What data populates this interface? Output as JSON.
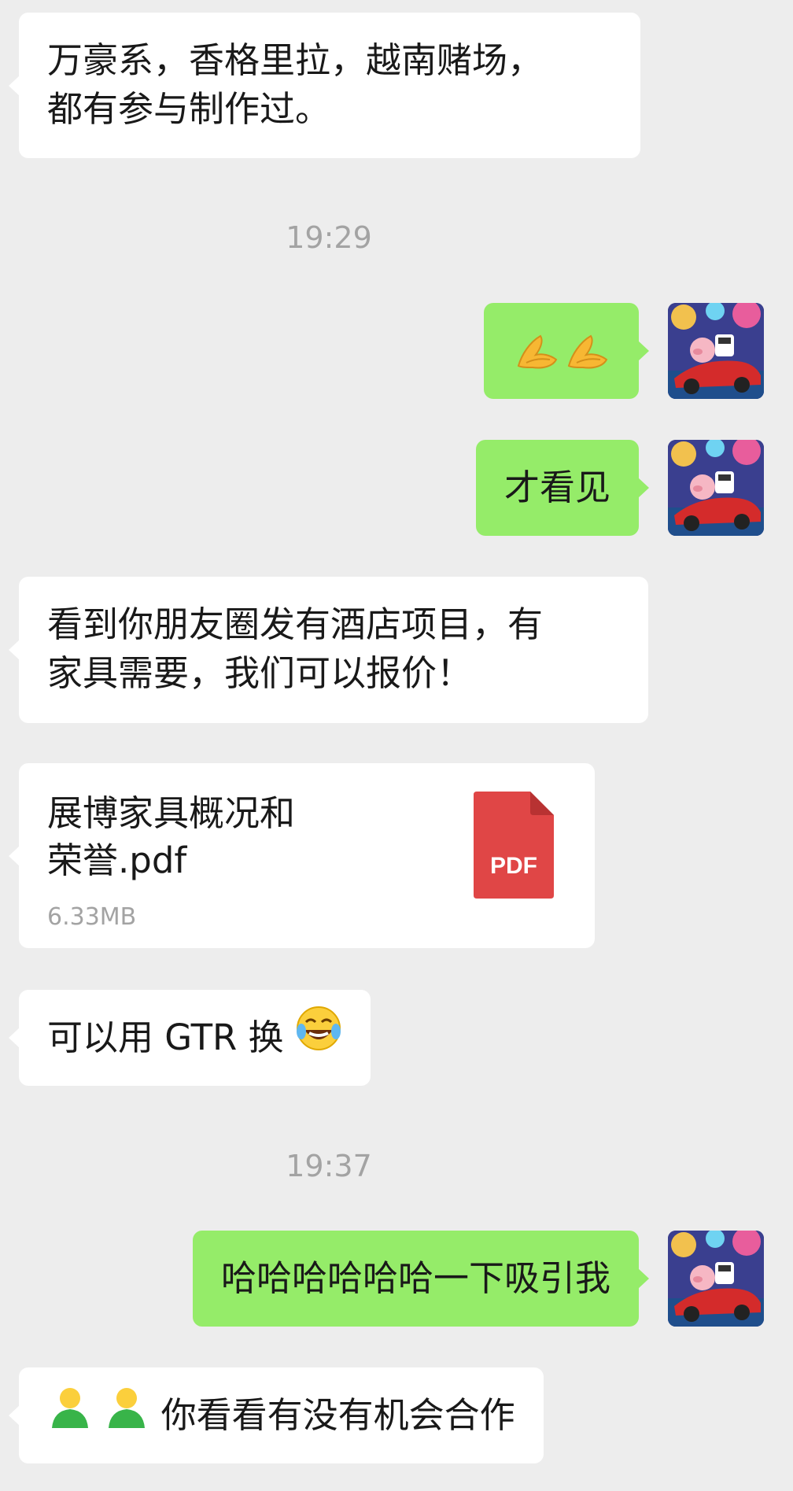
{
  "messages": {
    "m1": {
      "line1": "万豪系，香格里拉，越南赌场，",
      "line2": "都有参与制作过。"
    },
    "time1": "19:29",
    "m2": {
      "emoji": "folded-hands-emoji x2"
    },
    "m3": {
      "text": "才看见"
    },
    "m4": {
      "line1": "看到你朋友圈发有酒店项目，有",
      "line2": "家具需要，我们可以报价！"
    },
    "m5": {
      "line1": "展博家具概况和",
      "line2": "荣誉.pdf",
      "size": "6.33MB",
      "badge": "PDF"
    },
    "m6": {
      "text": "可以用 GTR 换",
      "emoji": "laughing-tears-emoji"
    },
    "time2": "19:37",
    "m7": {
      "text": "哈哈哈哈哈哈一下吸引我"
    },
    "m8": {
      "emoji": "person-emoji x2",
      "text": "你看看有没有机会合作"
    }
  },
  "colors": {
    "background": "#ededed",
    "incoming_bubble": "#ffffff",
    "outgoing_bubble": "#95ec69",
    "timestamp": "#a3a3a3",
    "pdf_red": "#e04646"
  },
  "avatar": {
    "icon": "pig-racecar-avatar"
  }
}
